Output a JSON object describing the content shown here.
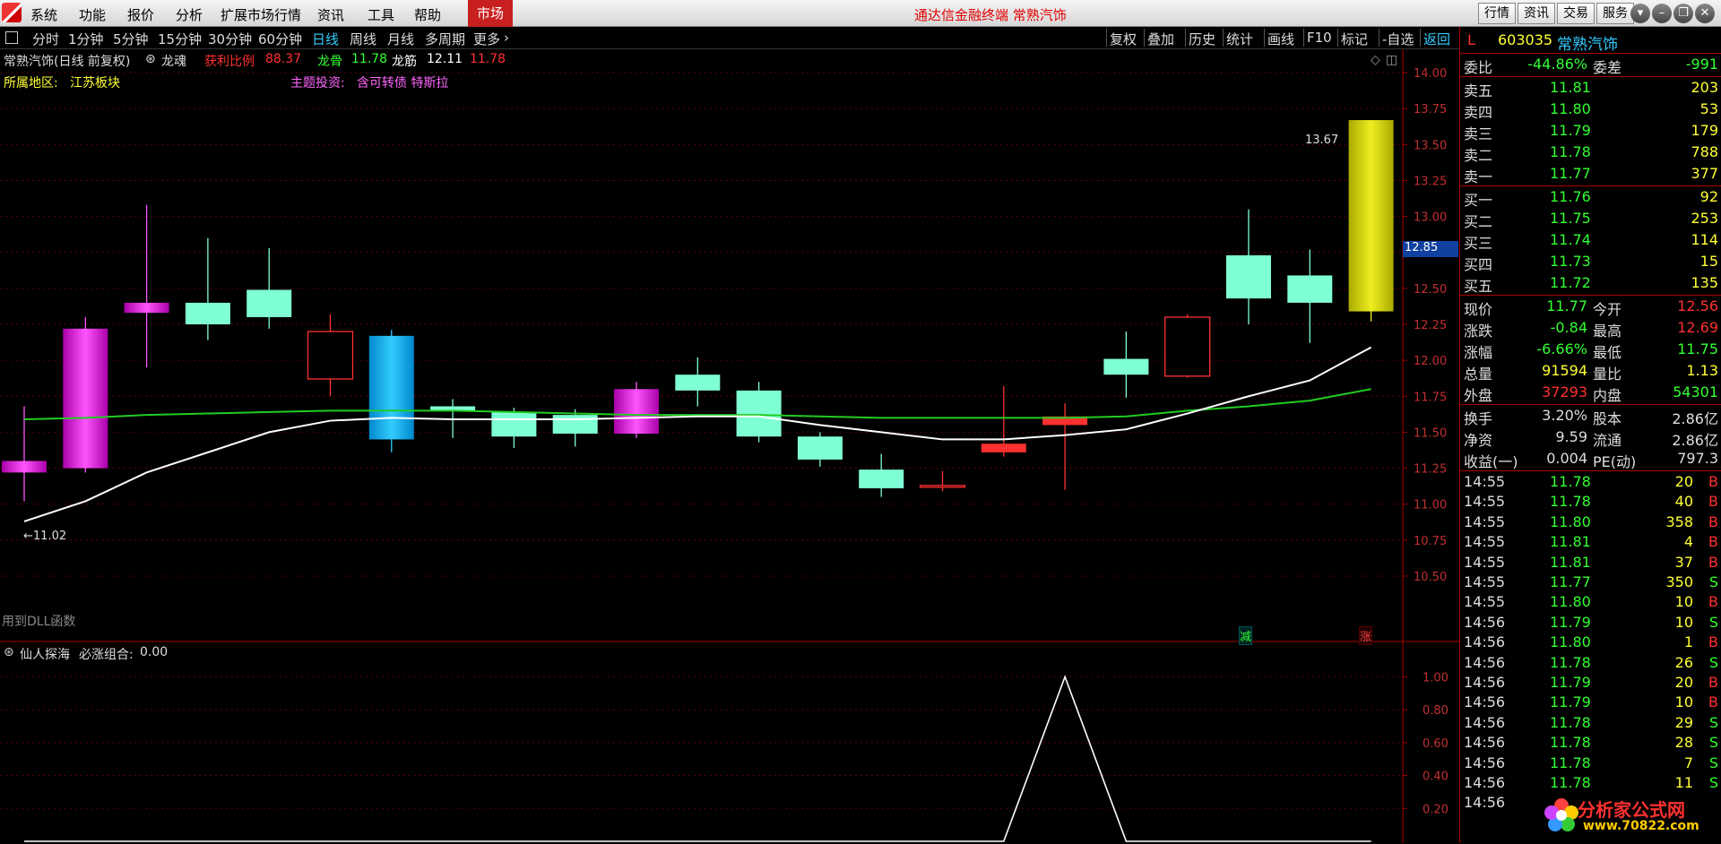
{
  "menubar": {
    "items": [
      "系统",
      "功能",
      "报价",
      "分析",
      "扩展市场行情",
      "资讯",
      "工具",
      "帮助"
    ],
    "active": "市场",
    "title": "通达信金融终端 常熟汽饰",
    "right_buttons": [
      "行情",
      "资讯",
      "交易",
      "服务"
    ]
  },
  "toolbar": {
    "periods": [
      "分时",
      "1分钟",
      "5分钟",
      "15分钟",
      "30分钟",
      "60分钟",
      "日线",
      "周线",
      "月线",
      "多周期",
      "更多"
    ],
    "active_period": "日线",
    "right_buttons": [
      "复权",
      "叠加",
      "历史",
      "统计",
      "画线",
      "F10",
      "标记",
      "-自选",
      "返回"
    ]
  },
  "chart": {
    "title": "常熟汽饰(日线 前复权)",
    "indicator": "龙魂",
    "profit_label": "获利比例",
    "profit_value": "88.37",
    "longgu_label": "龙骨",
    "longgu_value": "11.78",
    "longjin_label": "龙筋",
    "longjin_value": "12.11",
    "longjin_value2": "11.78",
    "region_label": "所属地区:",
    "region_value": "江苏板块",
    "theme_label": "主题投资:",
    "theme_value": "含可转债 特斯拉",
    "dll_note": "用到DLL函数",
    "price_ticks": [
      "14.00",
      "13.75",
      "13.50",
      "13.25",
      "13.00",
      "12.75",
      "12.50",
      "12.25",
      "12.00",
      "11.75",
      "11.50",
      "11.25",
      "11.00",
      "10.75",
      "10.50"
    ],
    "current_price_tag": "12.85",
    "high_label": "13.67",
    "low_label": "11.02",
    "marker_jian": "减",
    "marker_zhang": "涨",
    "colors": {
      "up": "#ff3030",
      "down": "#7fffd4",
      "ma1": "#ffffff",
      "ma2": "#22cc22",
      "grid": "#5a0000"
    }
  },
  "chart_data": [
    {
      "type": "candlestick",
      "title": "常熟汽饰(日线 前复权)",
      "candles": [
        {
          "o": 11.3,
          "c": 11.22,
          "h": 11.68,
          "l": 11.02,
          "color": "magenta"
        },
        {
          "o": 11.25,
          "c": 12.22,
          "h": 12.3,
          "l": 11.22,
          "color": "magenta"
        },
        {
          "o": 12.4,
          "c": 12.33,
          "h": 13.08,
          "l": 11.95,
          "color": "magenta"
        },
        {
          "o": 12.4,
          "c": 12.25,
          "h": 12.85,
          "l": 12.14,
          "color": "cyan"
        },
        {
          "o": 12.49,
          "c": 12.3,
          "h": 12.78,
          "l": 12.22,
          "color": "cyan"
        },
        {
          "o": 12.2,
          "c": 11.87,
          "h": 12.32,
          "l": 11.75,
          "color": "red-hollow"
        },
        {
          "o": 12.17,
          "c": 11.45,
          "h": 12.21,
          "l": 11.36,
          "color": "blue"
        },
        {
          "o": 11.68,
          "c": 11.65,
          "h": 11.73,
          "l": 11.46,
          "color": "cyan"
        },
        {
          "o": 11.64,
          "c": 11.47,
          "h": 11.67,
          "l": 11.39,
          "color": "cyan"
        },
        {
          "o": 11.62,
          "c": 11.49,
          "h": 11.66,
          "l": 11.4,
          "color": "cyan"
        },
        {
          "o": 11.49,
          "c": 11.8,
          "h": 11.85,
          "l": 11.46,
          "color": "magenta"
        },
        {
          "o": 11.9,
          "c": 11.79,
          "h": 12.02,
          "l": 11.68,
          "color": "cyan"
        },
        {
          "o": 11.79,
          "c": 11.47,
          "h": 11.85,
          "l": 11.43,
          "color": "cyan"
        },
        {
          "o": 11.47,
          "c": 11.31,
          "h": 11.5,
          "l": 11.26,
          "color": "cyan"
        },
        {
          "o": 11.24,
          "c": 11.11,
          "h": 11.35,
          "l": 11.05,
          "color": "cyan"
        },
        {
          "o": 11.12,
          "c": 11.13,
          "h": 11.23,
          "l": 11.09,
          "color": "red-hollow"
        },
        {
          "o": 11.36,
          "c": 11.42,
          "h": 11.82,
          "l": 11.33,
          "color": "red"
        },
        {
          "o": 11.55,
          "c": 11.61,
          "h": 11.7,
          "l": 11.1,
          "color": "red"
        },
        {
          "o": 12.01,
          "c": 11.9,
          "h": 12.2,
          "l": 11.74,
          "color": "cyan"
        },
        {
          "o": 11.89,
          "c": 12.3,
          "h": 12.32,
          "l": 11.88,
          "color": "red-hollow"
        },
        {
          "o": 12.73,
          "c": 12.43,
          "h": 13.05,
          "l": 12.25,
          "color": "cyan"
        },
        {
          "o": 12.59,
          "c": 12.4,
          "h": 12.77,
          "l": 12.12,
          "color": "cyan"
        },
        {
          "o": 12.34,
          "c": 13.67,
          "h": 13.67,
          "l": 12.27,
          "color": "yellow"
        }
      ],
      "ma_white": [
        10.88,
        11.02,
        11.22,
        11.36,
        11.5,
        11.58,
        11.6,
        11.59,
        11.59,
        11.59,
        11.6,
        11.61,
        11.61,
        11.55,
        11.5,
        11.45,
        11.45,
        11.48,
        11.52,
        11.63,
        11.75,
        11.86,
        12.09
      ],
      "ma_green": [
        11.59,
        11.6,
        11.62,
        11.63,
        11.64,
        11.65,
        11.65,
        11.65,
        11.64,
        11.63,
        11.62,
        11.62,
        11.62,
        11.61,
        11.6,
        11.6,
        11.6,
        11.6,
        11.61,
        11.65,
        11.68,
        11.72,
        11.8
      ],
      "ylim": [
        10.4,
        14.1
      ]
    },
    {
      "type": "line",
      "title": "仙人探海 必涨组合: 0.00",
      "values": [
        0,
        0,
        0,
        0,
        0,
        0,
        0,
        0,
        0,
        0,
        0,
        0,
        0,
        0,
        0,
        0,
        0,
        1,
        0,
        0,
        0,
        0,
        0
      ],
      "yticks": [
        "1.00",
        "0.80",
        "0.60",
        "0.40",
        "0.20"
      ],
      "ylim": [
        0,
        1.1
      ]
    }
  ],
  "subchart": {
    "name": "仙人探海",
    "label": "必涨组合:",
    "value": "0.00"
  },
  "quote": {
    "code": "603035",
    "name": "常熟汽饰",
    "flag": "L",
    "weibi_label": "委比",
    "weibi": "-44.86%",
    "weicha_label": "委差",
    "weicha": "-991",
    "asks": [
      {
        "label": "卖五",
        "price": "11.81",
        "vol": "203"
      },
      {
        "label": "卖四",
        "price": "11.80",
        "vol": "53"
      },
      {
        "label": "卖三",
        "price": "11.79",
        "vol": "179"
      },
      {
        "label": "卖二",
        "price": "11.78",
        "vol": "788"
      },
      {
        "label": "卖一",
        "price": "11.77",
        "vol": "377"
      }
    ],
    "bids": [
      {
        "label": "买一",
        "price": "11.76",
        "vol": "92"
      },
      {
        "label": "买二",
        "price": "11.75",
        "vol": "253"
      },
      {
        "label": "买三",
        "price": "11.74",
        "vol": "114"
      },
      {
        "label": "买四",
        "price": "11.73",
        "vol": "15"
      },
      {
        "label": "买五",
        "price": "11.72",
        "vol": "135"
      }
    ],
    "stats": [
      {
        "l1": "现价",
        "v1": "11.77",
        "l2": "今开",
        "v2": "12.56"
      },
      {
        "l1": "涨跌",
        "v1": "-0.84",
        "l2": "最高",
        "v2": "12.69"
      },
      {
        "l1": "涨幅",
        "v1": "-6.66%",
        "l2": "最低",
        "v2": "11.75"
      },
      {
        "l1": "总量",
        "v1": "91594",
        "l2": "量比",
        "v2": "1.13"
      },
      {
        "l1": "外盘",
        "v1": "37293",
        "l2": "内盘",
        "v2": "54301"
      }
    ],
    "stats2": [
      {
        "l1": "换手",
        "v1": "3.20%",
        "l2": "股本",
        "v2": "2.86亿"
      },
      {
        "l1": "净资",
        "v1": "9.59",
        "l2": "流通",
        "v2": "2.86亿"
      },
      {
        "l1": "收益(一)",
        "v1": "0.004",
        "l2": "PE(动)",
        "v2": "797.3"
      }
    ],
    "ticks": [
      {
        "t": "14:55",
        "p": "11.78",
        "v": "20",
        "s": "B"
      },
      {
        "t": "14:55",
        "p": "11.78",
        "v": "40",
        "s": "B"
      },
      {
        "t": "14:55",
        "p": "11.80",
        "v": "358",
        "s": "B"
      },
      {
        "t": "14:55",
        "p": "11.81",
        "v": "4",
        "s": "B"
      },
      {
        "t": "14:55",
        "p": "11.81",
        "v": "37",
        "s": "B"
      },
      {
        "t": "14:55",
        "p": "11.77",
        "v": "350",
        "s": "S"
      },
      {
        "t": "14:55",
        "p": "11.80",
        "v": "10",
        "s": "B"
      },
      {
        "t": "14:56",
        "p": "11.79",
        "v": "10",
        "s": "S"
      },
      {
        "t": "14:56",
        "p": "11.80",
        "v": "1",
        "s": "B"
      },
      {
        "t": "14:56",
        "p": "11.78",
        "v": "26",
        "s": "S"
      },
      {
        "t": "14:56",
        "p": "11.79",
        "v": "20",
        "s": "B"
      },
      {
        "t": "14:56",
        "p": "11.79",
        "v": "10",
        "s": "B"
      },
      {
        "t": "14:56",
        "p": "11.78",
        "v": "29",
        "s": "S"
      },
      {
        "t": "14:56",
        "p": "11.78",
        "v": "28",
        "s": "S"
      },
      {
        "t": "14:56",
        "p": "11.78",
        "v": "7",
        "s": "S"
      },
      {
        "t": "14:56",
        "p": "11.78",
        "v": "11",
        "s": "S"
      },
      {
        "t": "14:56",
        "p": "",
        "v": "",
        "s": ""
      }
    ]
  },
  "watermark": {
    "text": "分析家公式网",
    "url": "www.70822.com"
  }
}
